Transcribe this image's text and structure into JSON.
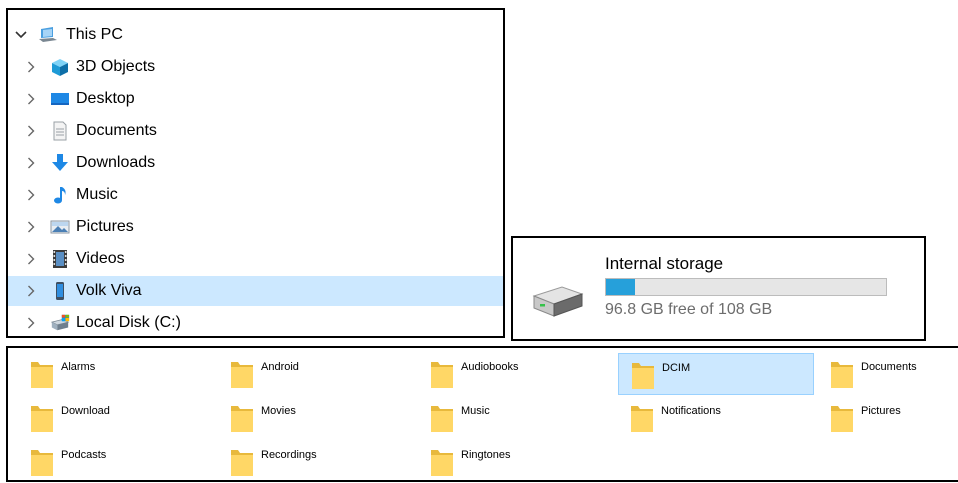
{
  "tree": {
    "root": {
      "label": "This PC",
      "icon": "computer-icon",
      "expanded": true
    },
    "items": [
      {
        "label": "3D Objects",
        "icon": "3d-objects-icon",
        "selected": false
      },
      {
        "label": "Desktop",
        "icon": "desktop-icon",
        "selected": false
      },
      {
        "label": "Documents",
        "icon": "documents-icon",
        "selected": false
      },
      {
        "label": "Downloads",
        "icon": "downloads-icon",
        "selected": false
      },
      {
        "label": "Music",
        "icon": "music-icon",
        "selected": false
      },
      {
        "label": "Pictures",
        "icon": "pictures-icon",
        "selected": false
      },
      {
        "label": "Videos",
        "icon": "videos-icon",
        "selected": false
      },
      {
        "label": "Volk Viva",
        "icon": "phone-icon",
        "selected": true
      },
      {
        "label": "Local Disk (C:)",
        "icon": "local-disk-icon",
        "selected": false
      }
    ]
  },
  "storage": {
    "title": "Internal storage",
    "free_text": "96.8 GB free of 108 GB",
    "used_fraction": 0.104,
    "icon": "drive-icon",
    "bar_color": "#26a0da"
  },
  "folders": [
    {
      "name": "Alarms",
      "selected": false
    },
    {
      "name": "Android",
      "selected": false
    },
    {
      "name": "Audiobooks",
      "selected": false
    },
    {
      "name": "DCIM",
      "selected": true
    },
    {
      "name": "Documents",
      "selected": false
    },
    {
      "name": "Download",
      "selected": false
    },
    {
      "name": "Movies",
      "selected": false
    },
    {
      "name": "Music",
      "selected": false
    },
    {
      "name": "Notifications",
      "selected": false
    },
    {
      "name": "Pictures",
      "selected": false
    },
    {
      "name": "Podcasts",
      "selected": false
    },
    {
      "name": "Recordings",
      "selected": false
    },
    {
      "name": "Ringtones",
      "selected": false
    }
  ],
  "colors": {
    "selection": "#cce8ff",
    "selection_border": "#99d1ff",
    "folder": "#ffd766"
  }
}
